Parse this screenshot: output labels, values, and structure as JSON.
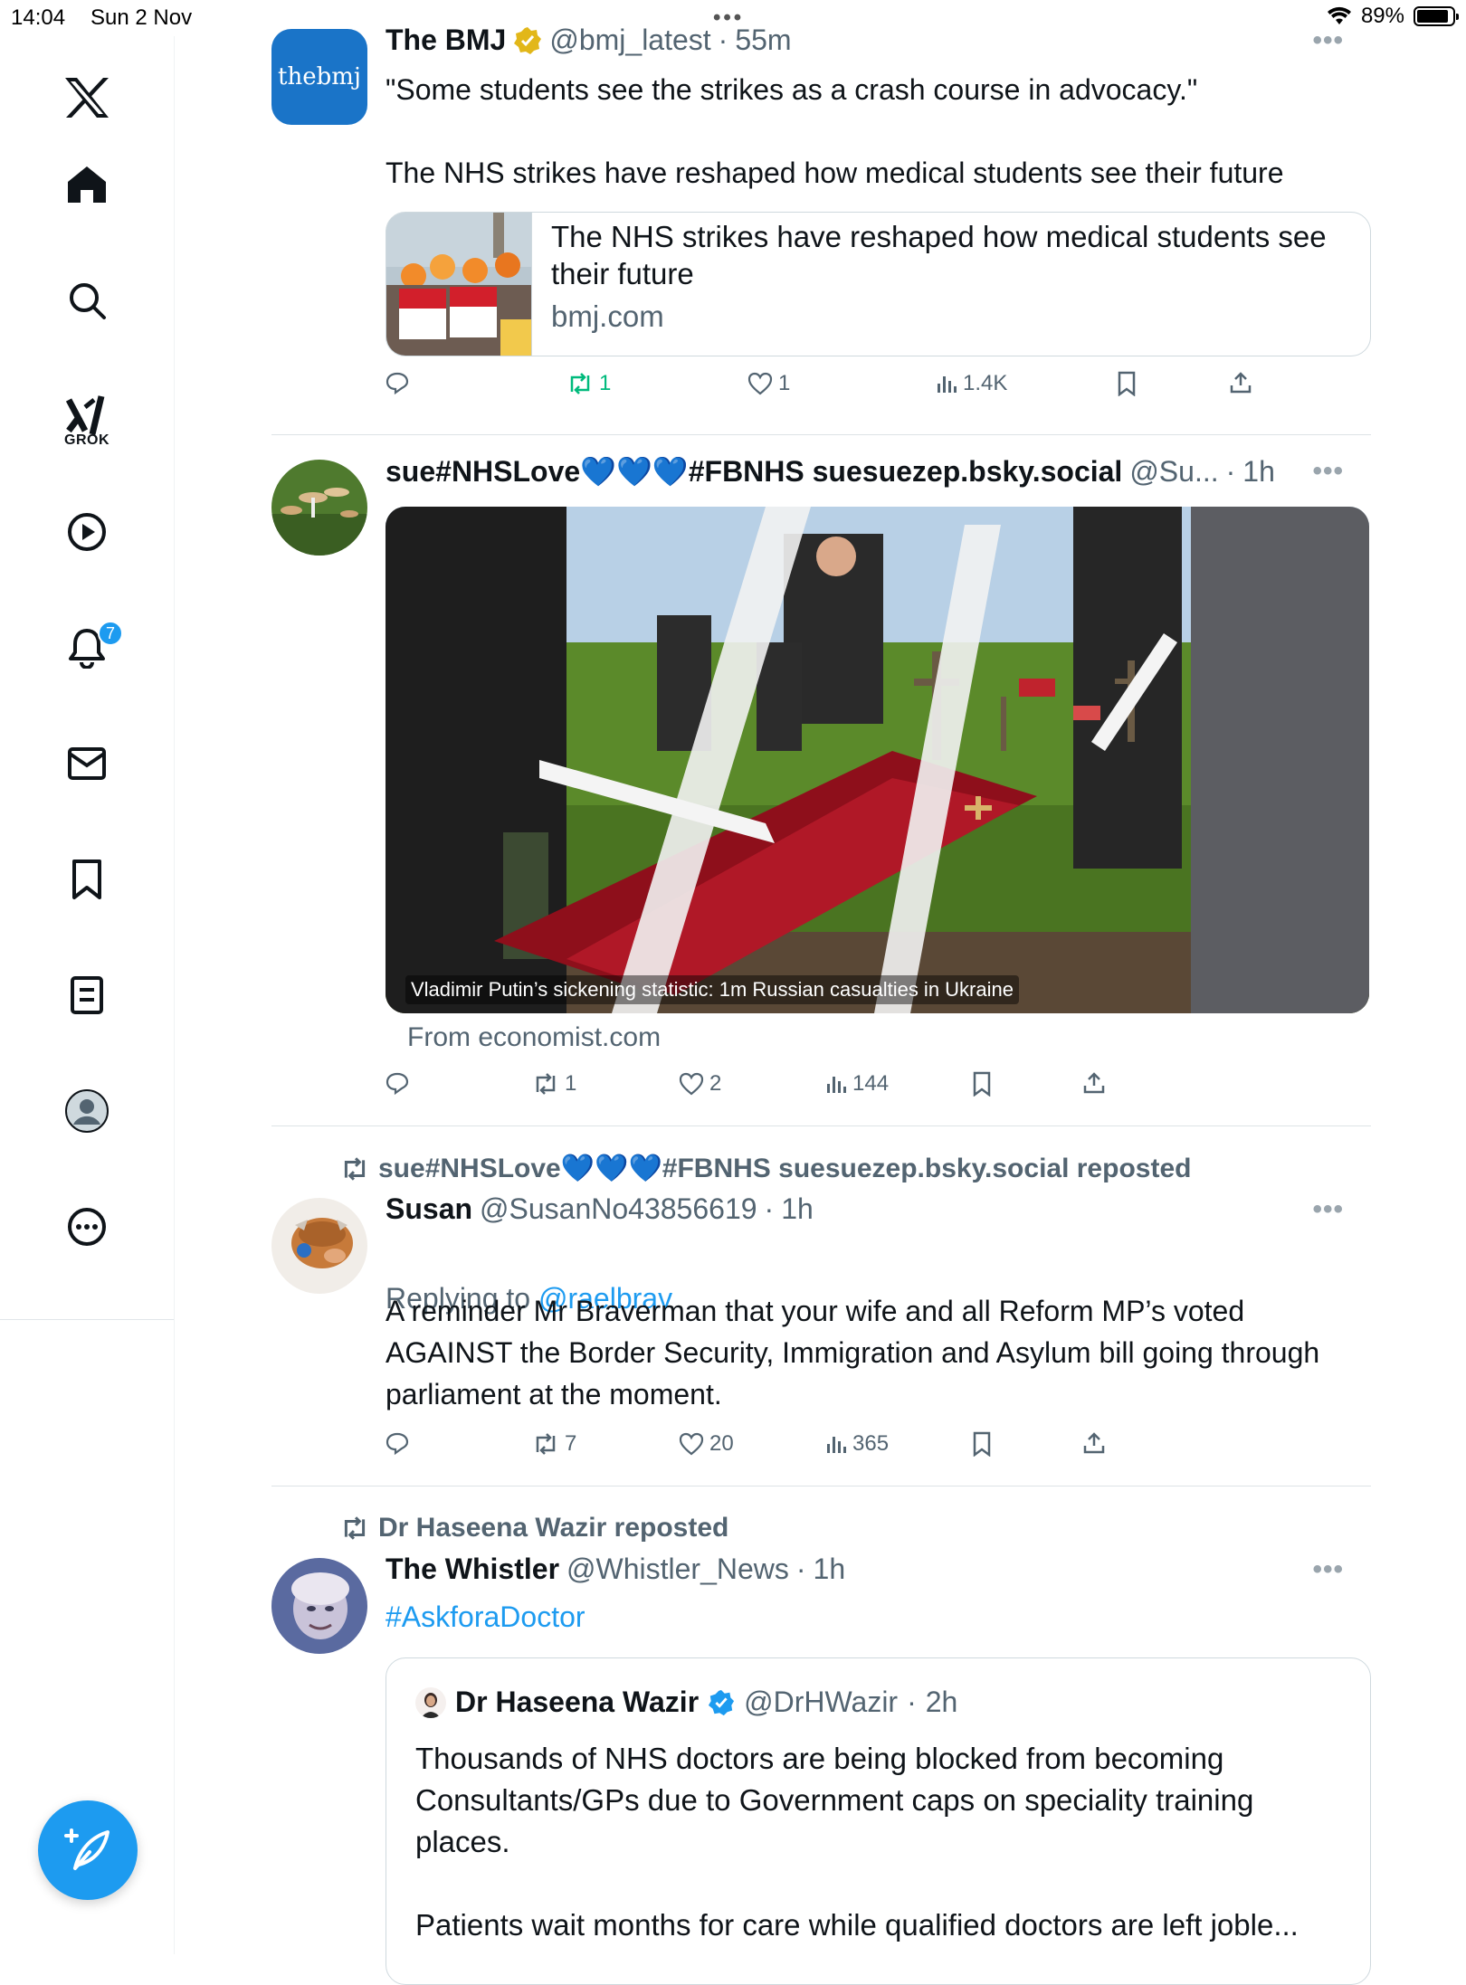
{
  "status_bar": {
    "time": "14:04",
    "date": "Sun 2 Nov",
    "battery_pct": "89%",
    "battery_level": 0.89
  },
  "sidebar": {
    "grok_label": "GROK",
    "notification_count": "7",
    "icons": [
      "x-logo-icon",
      "home-icon",
      "search-icon",
      "grok-icon",
      "video-icon",
      "bell-icon",
      "mail-icon",
      "bookmark-icon",
      "list-icon",
      "profile-icon",
      "more-icon"
    ]
  },
  "compose_icon": "compose-plus-icon",
  "tweets": [
    {
      "name": "The BMJ",
      "handle": "@bmj_latest",
      "dot": "·",
      "time": "55m",
      "avatar_text": "thebmj",
      "text": "\"Some students see the strikes as a crash course in advocacy.\"\n\nThe NHS strikes have reshaped how medical students see their future",
      "card": {
        "title": "The NHS strikes have reshaped how medical students see their future",
        "domain": "bmj.com"
      },
      "replies": "",
      "reposts": "1",
      "likes": "1",
      "views": "1.4K"
    },
    {
      "name": "sue#NHSLove💙💙💙#FBNHS suesuezep.bsky.social",
      "handle": "@Su...",
      "dot": "·",
      "time": "1h",
      "media_caption": "Vladimir Putin’s sickening statistic: 1m Russian casualties in Ukraine",
      "from": "From economist.com",
      "replies": "",
      "reposts": "1",
      "likes": "2",
      "views": "144"
    },
    {
      "repost_by": "sue#NHSLove💙💙💙#FBNHS suesuezep.bsky.social reposted",
      "name": "Susan",
      "handle": "@SusanNo43856619",
      "dot": "·",
      "time": "1h",
      "replying_prefix": "Replying to ",
      "replying_to": "@raelbrav",
      "text": "A reminder Mr Braverman that your wife and all Reform MP’s voted AGAINST the Border Security, Immigration and Asylum bill going through parliament at the moment.",
      "replies": "",
      "reposts": "7",
      "likes": "20",
      "views": "365"
    },
    {
      "repost_by": "Dr Haseena Wazir reposted",
      "name": "The Whistler",
      "handle": "@Whistler_News",
      "dot": "·",
      "time": "1h",
      "text": "#AskforaDoctor",
      "quote": {
        "name": "Dr Haseena Wazir",
        "handle": "@DrHWazir",
        "dot": "·",
        "time": "2h",
        "text": "Thousands of NHS doctors are being blocked from becoming Consultants/GPs due to Government caps on speciality training places.\n\nPatients wait months for care while qualified doctors are left joble..."
      }
    }
  ],
  "colors": {
    "accent": "#1d9bf0",
    "repost_active": "#00ba7c",
    "muted": "#536471"
  }
}
